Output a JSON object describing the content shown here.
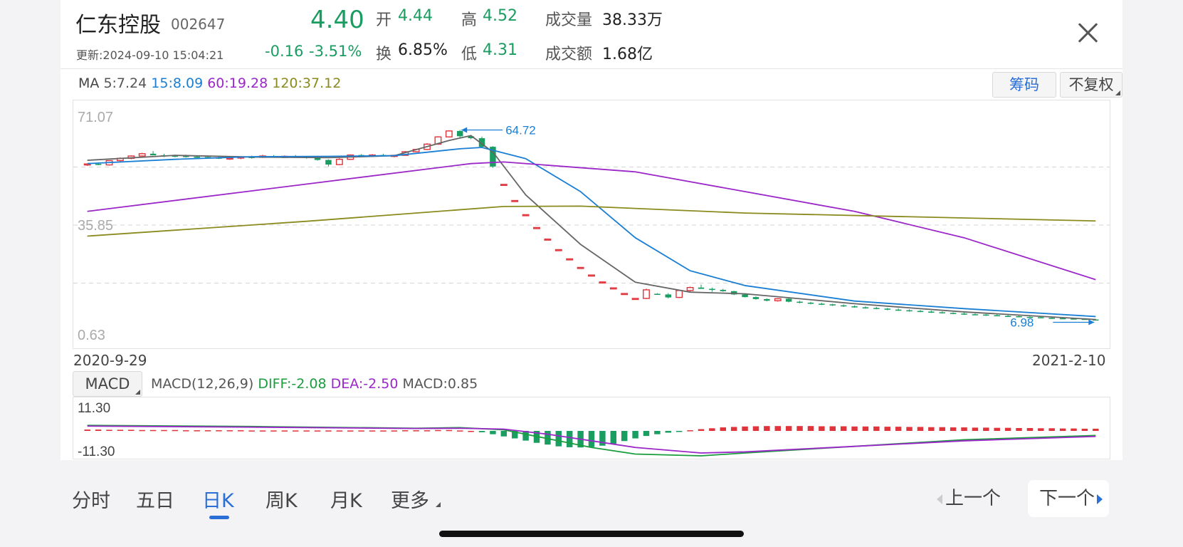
{
  "stock": {
    "name": "仁东控股",
    "code": "002647",
    "price": "4.40",
    "change": "-0.16",
    "change_pct": "-3.51%",
    "updated": "更新:2024-09-10 15:04:21",
    "open_label": "开",
    "open": "4.44",
    "high_label": "高",
    "high": "4.52",
    "turnover_label": "换",
    "turnover": "6.85%",
    "low_label": "低",
    "low": "4.31",
    "volume_label": "成交量",
    "volume": "38.33万",
    "amount_label": "成交额",
    "amount": "1.68亿"
  },
  "ma_legend": {
    "title": "MA",
    "ma5": "5:7.24",
    "ma15": "15:8.09",
    "ma60": "60:19.28",
    "ma120": "120:37.12"
  },
  "buttons": {
    "chips": "筹码",
    "adjust": "不复权"
  },
  "macd_legend": {
    "selector": "MACD",
    "params": "MACD(12,26,9)",
    "diff": "DIFF:-2.08",
    "dea": "DEA:-2.50",
    "macd": "MACD:0.85"
  },
  "tabs": [
    "分时",
    "五日",
    "日K",
    "周K",
    "月K",
    "更多"
  ],
  "active_tab": "日K",
  "nav": {
    "prev": "上一个",
    "next": "下一个"
  },
  "colors": {
    "up": "#e0343c",
    "down": "#1a9d61",
    "ma5": "#666666",
    "ma15": "#1a7fd4",
    "ma60": "#9b27c9",
    "ma120": "#8a8a1e",
    "accent": "#2a6fd6"
  },
  "chart_data": [
    {
      "type": "candlestick",
      "title": "",
      "y_ticks": [
        "71.07",
        "35.85",
        "0.63"
      ],
      "ylim": [
        0.63,
        71.07
      ],
      "x_ticks": [
        "2020-9-29",
        "2021-2-10"
      ],
      "grid": true,
      "annotations": [
        {
          "label": "64.72",
          "type": "max"
        },
        {
          "label": "6.98",
          "type": "min"
        }
      ],
      "candles": [
        [
          54.2,
          54.5,
          53.8,
          54.4
        ],
        [
          54.4,
          54.7,
          54.0,
          54.1
        ],
        [
          54.1,
          55.5,
          53.9,
          55.4
        ],
        [
          55.4,
          56.4,
          55.1,
          56.1
        ],
        [
          56.1,
          57.0,
          55.8,
          56.8
        ],
        [
          56.8,
          57.8,
          56.5,
          57.5
        ],
        [
          57.5,
          58.3,
          57.2,
          57.0
        ],
        [
          57.0,
          57.5,
          56.5,
          56.9
        ],
        [
          56.9,
          57.2,
          56.4,
          56.8
        ],
        [
          56.8,
          57.2,
          56.3,
          56.6
        ],
        [
          56.6,
          57.0,
          56.2,
          56.5
        ],
        [
          56.5,
          56.9,
          56.1,
          56.3
        ],
        [
          56.3,
          56.8,
          55.9,
          56.0
        ],
        [
          56.0,
          56.6,
          55.6,
          56.2
        ],
        [
          56.2,
          56.7,
          55.8,
          56.5
        ],
        [
          56.5,
          56.9,
          56.0,
          56.4
        ],
        [
          56.4,
          57.2,
          56.2,
          56.8
        ],
        [
          56.8,
          57.1,
          56.4,
          56.6
        ],
        [
          56.6,
          57.0,
          56.2,
          56.7
        ],
        [
          56.7,
          57.1,
          56.3,
          56.5
        ],
        [
          56.5,
          56.8,
          56.0,
          56.3
        ],
        [
          56.3,
          56.6,
          55.4,
          55.6
        ],
        [
          55.6,
          55.8,
          53.6,
          54.2
        ],
        [
          54.2,
          56.2,
          54.0,
          55.8
        ],
        [
          55.8,
          57.3,
          55.6,
          57.1
        ],
        [
          57.1,
          57.4,
          56.6,
          56.9
        ],
        [
          56.9,
          57.4,
          56.5,
          57.1
        ],
        [
          57.1,
          57.5,
          56.6,
          56.8
        ],
        [
          56.8,
          57.2,
          56.4,
          57.0
        ],
        [
          57.0,
          58.3,
          56.9,
          58.1
        ],
        [
          58.1,
          59.0,
          57.9,
          58.8
        ],
        [
          58.8,
          60.7,
          58.6,
          60.4
        ],
        [
          60.4,
          62.8,
          60.2,
          62.6
        ],
        [
          62.6,
          64.6,
          62.4,
          64.4
        ],
        [
          64.4,
          64.7,
          62.4,
          62.8
        ],
        [
          62.8,
          63.2,
          61.9,
          62.2
        ],
        [
          62.2,
          62.7,
          59.3,
          59.6
        ],
        [
          59.6,
          59.8,
          53.2,
          53.6
        ],
        [
          48.2,
          48.2,
          48.2,
          48.2
        ],
        [
          43.3,
          43.3,
          43.3,
          43.3
        ],
        [
          39.0,
          39.0,
          39.0,
          39.0
        ],
        [
          35.1,
          35.1,
          35.1,
          35.1
        ],
        [
          31.6,
          31.6,
          31.6,
          31.6
        ],
        [
          28.4,
          28.4,
          28.4,
          28.4
        ],
        [
          25.6,
          25.6,
          25.6,
          25.6
        ],
        [
          23.0,
          23.0,
          23.0,
          23.0
        ],
        [
          20.7,
          20.7,
          20.7,
          20.7
        ],
        [
          18.6,
          18.6,
          18.6,
          18.6
        ],
        [
          16.8,
          16.8,
          16.8,
          16.8
        ],
        [
          15.1,
          15.1,
          15.1,
          15.1
        ],
        [
          13.6,
          13.6,
          13.6,
          13.6
        ],
        [
          13.6,
          16.6,
          13.4,
          16.2
        ],
        [
          15.0,
          15.2,
          14.7,
          14.8
        ],
        [
          14.8,
          15.2,
          13.6,
          13.9
        ],
        [
          13.9,
          16.2,
          13.7,
          16.0
        ],
        [
          16.0,
          17.2,
          15.6,
          16.9
        ],
        [
          16.9,
          17.8,
          16.5,
          16.5
        ],
        [
          16.5,
          16.9,
          15.6,
          16.2
        ],
        [
          16.2,
          16.5,
          15.6,
          15.8
        ],
        [
          15.8,
          15.9,
          14.6,
          14.8
        ],
        [
          14.8,
          15.0,
          13.9,
          14.0
        ],
        [
          14.0,
          14.2,
          13.2,
          13.4
        ],
        [
          13.4,
          13.6,
          12.7,
          12.9
        ],
        [
          12.9,
          13.7,
          12.6,
          13.5
        ],
        [
          13.5,
          13.7,
          12.4,
          12.6
        ],
        [
          12.6,
          12.9,
          12.1,
          12.3
        ],
        [
          12.3,
          12.6,
          11.8,
          12.0
        ],
        [
          12.0,
          12.3,
          11.6,
          11.8
        ],
        [
          11.8,
          12.0,
          11.3,
          11.5
        ],
        [
          11.5,
          11.8,
          11.0,
          11.2
        ],
        [
          11.2,
          11.5,
          10.8,
          10.9
        ],
        [
          10.9,
          11.2,
          10.5,
          10.7
        ],
        [
          10.7,
          11.0,
          10.3,
          10.5
        ],
        [
          10.5,
          10.7,
          10.0,
          10.2
        ],
        [
          10.2,
          10.6,
          9.8,
          10.0
        ],
        [
          10.0,
          10.3,
          9.6,
          9.8
        ],
        [
          9.8,
          10.1,
          9.4,
          9.6
        ],
        [
          9.6,
          9.9,
          9.2,
          9.4
        ],
        [
          9.4,
          9.7,
          9.0,
          9.2
        ],
        [
          9.2,
          9.4,
          8.8,
          9.0
        ],
        [
          9.0,
          9.3,
          8.6,
          8.8
        ],
        [
          8.8,
          9.1,
          8.5,
          8.7
        ],
        [
          8.7,
          8.9,
          8.3,
          8.5
        ],
        [
          8.5,
          8.8,
          8.2,
          8.3
        ],
        [
          8.3,
          8.6,
          8.0,
          8.2
        ],
        [
          8.2,
          8.4,
          7.9,
          8.0
        ],
        [
          8.0,
          8.3,
          7.7,
          7.9
        ],
        [
          7.9,
          8.1,
          7.6,
          7.7
        ],
        [
          7.7,
          8.0,
          7.5,
          7.6
        ],
        [
          7.6,
          7.9,
          7.4,
          7.5
        ],
        [
          7.5,
          7.7,
          7.2,
          7.4
        ],
        [
          7.4,
          7.6,
          7.1,
          7.2
        ],
        [
          7.2,
          7.4,
          7.0,
          7.1
        ]
      ],
      "series": [
        {
          "name": "MA5",
          "x": [
            0,
            8,
            15,
            22,
            28,
            33,
            35,
            37,
            40,
            45,
            50,
            55,
            60,
            70,
            80,
            92
          ],
          "values": [
            55.5,
            57.0,
            56.5,
            56.3,
            56.9,
            61.5,
            63.0,
            58.0,
            45.0,
            30.0,
            18.5,
            15.5,
            15.0,
            12.0,
            9.5,
            7.2
          ]
        },
        {
          "name": "MA15",
          "x": [
            0,
            8,
            15,
            22,
            28,
            34,
            36,
            40,
            45,
            50,
            55,
            60,
            70,
            80,
            92
          ],
          "values": [
            54.5,
            55.8,
            56.6,
            56.7,
            56.9,
            59.0,
            59.4,
            56.0,
            46.0,
            32.0,
            22.0,
            17.5,
            12.8,
            10.5,
            8.1
          ]
        },
        {
          "name": "MA60",
          "x": [
            0,
            35,
            38,
            50,
            60,
            70,
            80,
            92
          ],
          "values": [
            40.0,
            54.5,
            55.0,
            52.0,
            46.0,
            40.0,
            32.0,
            19.3
          ]
        },
        {
          "name": "MA120",
          "x": [
            0,
            20,
            38,
            45,
            60,
            92
          ],
          "values": [
            32.5,
            37.0,
            41.5,
            41.6,
            39.5,
            37.1
          ]
        }
      ]
    },
    {
      "type": "macd",
      "title": "",
      "y_ticks": [
        "11.30",
        "-11.30"
      ],
      "ylim": [
        -11.3,
        11.3
      ],
      "bars": [
        0.6,
        0.6,
        0.5,
        0.5,
        0.5,
        0.4,
        0.4,
        0.4,
        0.4,
        0.3,
        0.3,
        0.3,
        0.3,
        0.3,
        0.3,
        0.2,
        0.2,
        0.2,
        0.2,
        0.2,
        0.2,
        0.2,
        0.2,
        0.2,
        0.2,
        0.2,
        0.2,
        0.2,
        0.2,
        0.3,
        0.3,
        0.3,
        0.4,
        0.4,
        0.2,
        0.0,
        -0.6,
        -1.5,
        -2.5,
        -3.4,
        -4.4,
        -5.4,
        -6.2,
        -7.0,
        -7.4,
        -7.5,
        -7.3,
        -6.7,
        -5.8,
        -4.6,
        -3.4,
        -2.3,
        -1.5,
        -0.8,
        -0.3,
        0.3,
        0.8,
        1.2,
        1.6,
        1.8,
        2.0,
        2.1,
        2.2,
        2.2,
        2.2,
        2.2,
        2.2,
        2.1,
        2.1,
        2.1,
        2.0,
        2.0,
        2.0,
        1.9,
        1.9,
        1.8,
        1.8,
        1.7,
        1.7,
        1.6,
        1.6,
        1.5,
        1.5,
        1.4,
        1.4,
        1.3,
        1.3,
        1.2,
        1.2,
        1.1,
        1.1,
        1.0,
        1.0
      ],
      "series": [
        {
          "name": "DIFF",
          "x": [
            0,
            15,
            30,
            34,
            38,
            42,
            46,
            50,
            56,
            60,
            70,
            80,
            92
          ],
          "values": [
            2.5,
            2.0,
            1.2,
            1.5,
            0.5,
            -3.5,
            -7.5,
            -10.5,
            -11.3,
            -10.0,
            -7.0,
            -4.0,
            -2.08
          ]
        },
        {
          "name": "DEA",
          "x": [
            0,
            15,
            30,
            34,
            38,
            42,
            46,
            50,
            56,
            60,
            70,
            80,
            92
          ],
          "values": [
            2.2,
            1.7,
            1.1,
            1.2,
            0.8,
            -1.5,
            -4.5,
            -7.5,
            -10.0,
            -9.5,
            -7.0,
            -4.5,
            -2.5
          ]
        }
      ]
    }
  ]
}
